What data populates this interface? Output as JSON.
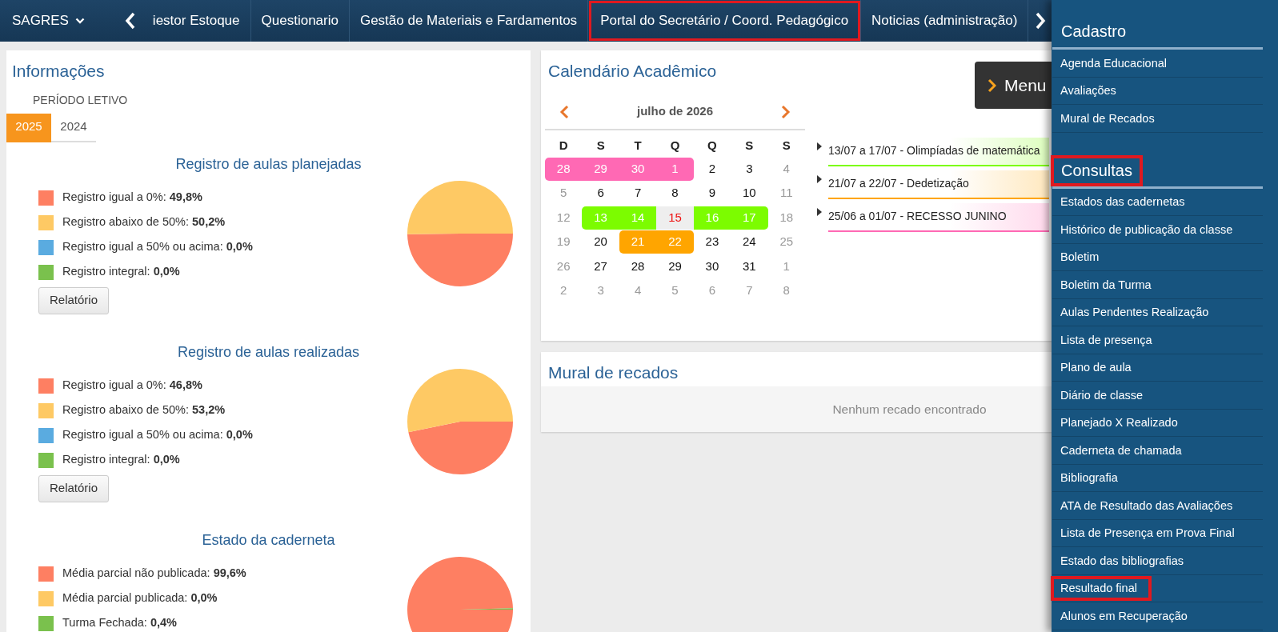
{
  "top_nav": {
    "brand": "SAGRES",
    "items": [
      {
        "label": "iestor Estoque",
        "highlighted": false
      },
      {
        "label": "Questionario",
        "highlighted": false
      },
      {
        "label": "Gestão de Materiais e Fardamentos",
        "highlighted": false
      },
      {
        "label": "Portal do Secretário / Coord. Pedagógico",
        "highlighted": true
      },
      {
        "label": "Noticias (administração)",
        "highlighted": false
      }
    ]
  },
  "info_panel": {
    "title": "Informações",
    "period_label": "PERÍODO LETIVO",
    "year_tabs": [
      {
        "label": "2025",
        "selected": true
      },
      {
        "label": "2024",
        "selected": false
      }
    ],
    "sections": [
      {
        "title": "Registro de aulas planejadas",
        "legend": [
          {
            "label": "Registro igual a 0%:",
            "value": "49,8%",
            "color": "#fe7f62"
          },
          {
            "label": "Registro abaixo de 50%:",
            "value": "50,2%",
            "color": "#fec964"
          },
          {
            "label": "Registro igual a 50% ou acima:",
            "value": "0,0%",
            "color": "#5aabe0"
          },
          {
            "label": "Registro integral:",
            "value": "0,0%",
            "color": "#7ac14d"
          }
        ],
        "button": "Relatório",
        "chart_data": {
          "type": "pie",
          "values": [
            49.8,
            50.2,
            0,
            0
          ]
        }
      },
      {
        "title": "Registro de aulas realizadas",
        "legend": [
          {
            "label": "Registro igual a 0%:",
            "value": "46,8%",
            "color": "#fe7f62"
          },
          {
            "label": "Registro abaixo de 50%:",
            "value": "53,2%",
            "color": "#fec964"
          },
          {
            "label": "Registro igual a 50% ou acima:",
            "value": "0,0%",
            "color": "#5aabe0"
          },
          {
            "label": "Registro integral:",
            "value": "0,0%",
            "color": "#7ac14d"
          }
        ],
        "button": "Relatório",
        "chart_data": {
          "type": "pie",
          "values": [
            46.8,
            53.2,
            0,
            0
          ]
        }
      },
      {
        "title": "Estado da caderneta",
        "legend": [
          {
            "label": "Média parcial não publicada:",
            "value": "99,6%",
            "color": "#fe7f62"
          },
          {
            "label": "Média parcial publicada:",
            "value": "0,0%",
            "color": "#fec964"
          },
          {
            "label": "Turma Fechada:",
            "value": "0,4%",
            "color": "#7ac14d"
          }
        ],
        "chart_data": {
          "type": "pie",
          "values": [
            99.6,
            0,
            0.4
          ]
        }
      }
    ]
  },
  "calendar": {
    "title": "Calendário Acadêmico",
    "month": "julho de 2026",
    "weekdays": [
      "D",
      "S",
      "T",
      "Q",
      "Q",
      "S",
      "S"
    ],
    "weeks": [
      [
        {
          "day": "28",
          "today": false,
          "color": "#ff69b4"
        },
        {
          "day": "29",
          "today": false,
          "color": "#ff69b4"
        },
        {
          "day": "30",
          "today": false,
          "color": "#ff69b4"
        },
        {
          "day": "1",
          "today": false,
          "color": "#ff69b4"
        },
        {
          "day": "2",
          "other_month": false,
          "today": false
        },
        {
          "day": "3",
          "other_month": false,
          "today": false
        },
        {
          "day": "4",
          "other_month": true,
          "today": false
        }
      ],
      [
        {
          "day": "5",
          "other_month": true,
          "today": false
        },
        {
          "day": "6",
          "other_month": false,
          "today": false
        },
        {
          "day": "7",
          "other_month": false,
          "today": false
        },
        {
          "day": "8",
          "other_month": false,
          "today": false
        },
        {
          "day": "9",
          "other_month": false,
          "today": false
        },
        {
          "day": "10",
          "other_month": false,
          "today": false
        },
        {
          "day": "11",
          "other_month": true,
          "today": false
        }
      ],
      [
        {
          "day": "12",
          "other_month": true,
          "today": false
        },
        {
          "day": "13",
          "today": false,
          "color": "#7cfc00"
        },
        {
          "day": "14",
          "today": false,
          "color": "#7cfc00"
        },
        {
          "day": "15",
          "today": true
        },
        {
          "day": "16",
          "today": false,
          "color": "#7cfc00"
        },
        {
          "day": "17",
          "today": false,
          "color": "#7cfc00"
        },
        {
          "day": "18",
          "other_month": true,
          "today": false
        }
      ],
      [
        {
          "day": "19",
          "other_month": true,
          "today": false
        },
        {
          "day": "20",
          "other_month": false,
          "today": false
        },
        {
          "day": "21",
          "today": false,
          "color": "#ffa500"
        },
        {
          "day": "22",
          "today": false,
          "color": "#ffa500"
        },
        {
          "day": "23",
          "other_month": false,
          "today": false
        },
        {
          "day": "24",
          "other_month": false,
          "today": false
        },
        {
          "day": "25",
          "other_month": true,
          "today": false
        }
      ],
      [
        {
          "day": "26",
          "other_month": true,
          "today": false
        },
        {
          "day": "27",
          "other_month": false,
          "today": false
        },
        {
          "day": "28",
          "other_month": false,
          "today": false
        },
        {
          "day": "29",
          "other_month": false,
          "today": false
        },
        {
          "day": "30",
          "other_month": false,
          "today": false
        },
        {
          "day": "31",
          "other_month": false,
          "today": false
        },
        {
          "day": "1",
          "other_month": true,
          "today": false
        }
      ],
      [
        {
          "day": "2",
          "other_month": true,
          "today": false
        },
        {
          "day": "3",
          "other_month": true,
          "today": false
        },
        {
          "day": "4",
          "other_month": true,
          "today": false
        },
        {
          "day": "5",
          "other_month": true,
          "today": false
        },
        {
          "day": "6",
          "other_month": true,
          "today": false
        },
        {
          "day": "7",
          "other_month": true,
          "today": false
        },
        {
          "day": "8",
          "other_month": true,
          "today": false
        }
      ]
    ],
    "events": [
      {
        "text": "13/07 a 17/07 - Olimpíadas de matemática",
        "color": "#7cfc00"
      },
      {
        "text": "21/07 a 22/07 - Dedetização",
        "color": "#ffa500"
      },
      {
        "text": "25/06 a 01/07 - RECESSO JUNINO",
        "color": "#ff69b4"
      }
    ]
  },
  "menu_button": {
    "label": "Menu"
  },
  "mural": {
    "title": "Mural de recados",
    "empty_message": "Nenhum recado encontrado"
  },
  "sidebar": {
    "sections": [
      {
        "title": "Cadastro",
        "highlighted": false,
        "items": [
          {
            "label": "Agenda Educacional",
            "highlighted": false
          },
          {
            "label": "Avaliações",
            "highlighted": false
          },
          {
            "label": "Mural de Recados",
            "highlighted": false
          }
        ]
      },
      {
        "title": "Consultas",
        "highlighted": true,
        "items": [
          {
            "label": "Estados das cadernetas",
            "highlighted": false
          },
          {
            "label": "Histórico de publicação da classe",
            "highlighted": false
          },
          {
            "label": "Boletim",
            "highlighted": false
          },
          {
            "label": "Boletim da Turma",
            "highlighted": false
          },
          {
            "label": "Aulas Pendentes Realização",
            "highlighted": false
          },
          {
            "label": "Lista de presença",
            "highlighted": false
          },
          {
            "label": "Plano de aula",
            "highlighted": false
          },
          {
            "label": "Diário de classe",
            "highlighted": false
          },
          {
            "label": "Planejado X Realizado",
            "highlighted": false
          },
          {
            "label": "Caderneta de chamada",
            "highlighted": false
          },
          {
            "label": "Bibliografia",
            "highlighted": false
          },
          {
            "label": "ATA de Resultado das Avaliações",
            "highlighted": false
          },
          {
            "label": "Lista de Presença em Prova Final",
            "highlighted": false
          },
          {
            "label": "Estado das bibliografias",
            "highlighted": false
          },
          {
            "label": "Resultado final",
            "highlighted": true
          },
          {
            "label": "Alunos em Recuperação",
            "highlighted": false
          }
        ]
      }
    ]
  }
}
